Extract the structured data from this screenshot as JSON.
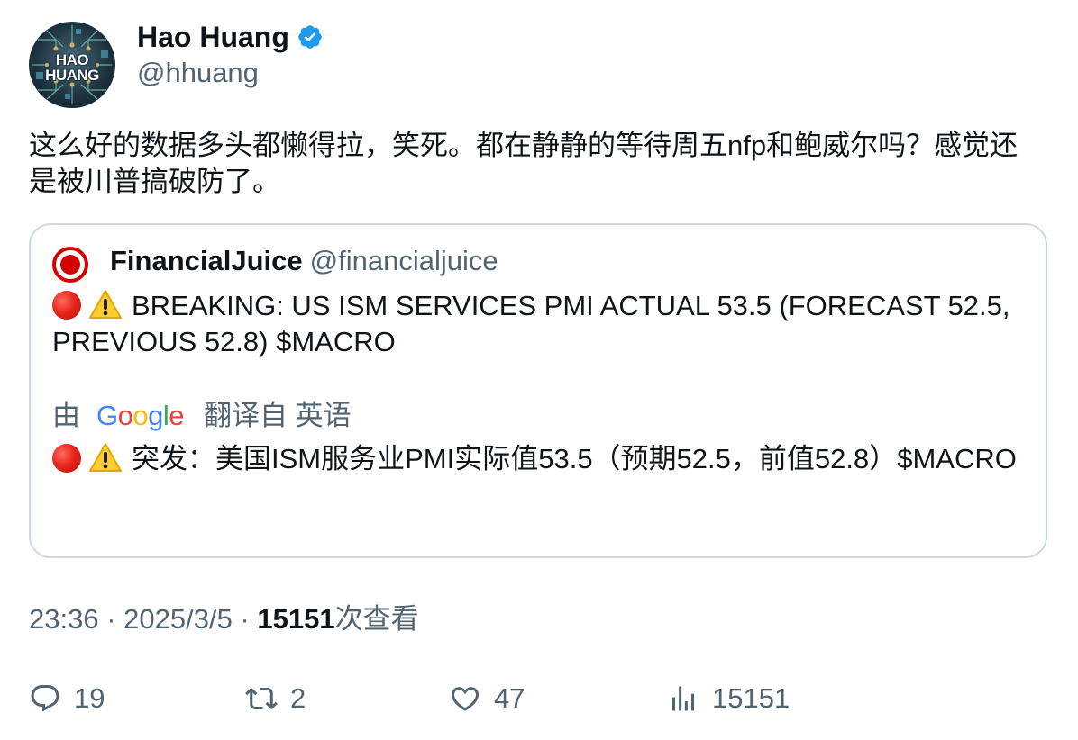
{
  "author": {
    "name": "Hao Huang",
    "handle": "@hhuang",
    "avatar_text_line1": "HAO",
    "avatar_text_line2": "HUANG",
    "verified": true
  },
  "tweet_text": "这么好的数据多头都懒得拉，笑死。都在静静的等待周五nfp和鲍威尔吗？感觉还是被川普搞破防了。",
  "quoted": {
    "name": "FinancialJuice",
    "handle": "@financialjuice",
    "text": "BREAKING: US ISM SERVICES PMI ACTUAL 53.5 (FORECAST 52.5, PREVIOUS 52.8) $MACRO",
    "translate_prefix": "由",
    "translate_logo": "Google",
    "translate_suffix": "翻译自 英语",
    "translated_text": "突发：美国ISM服务业PMI实际值53.5（预期52.5，前值52.8）$MACRO"
  },
  "meta": {
    "time": "23:36",
    "sep": "·",
    "date": "2025/3/5",
    "views_count": "15151",
    "views_label": "次查看"
  },
  "actions": {
    "reply_count": "19",
    "retweet_count": "2",
    "like_count": "47",
    "views_count": "15151"
  },
  "colors": {
    "verified": "#1d9bf0",
    "secondary_text": "#536471",
    "primary_text": "#0f1419",
    "border": "#cfd9de",
    "quote_avatar_red": "#d40000"
  }
}
